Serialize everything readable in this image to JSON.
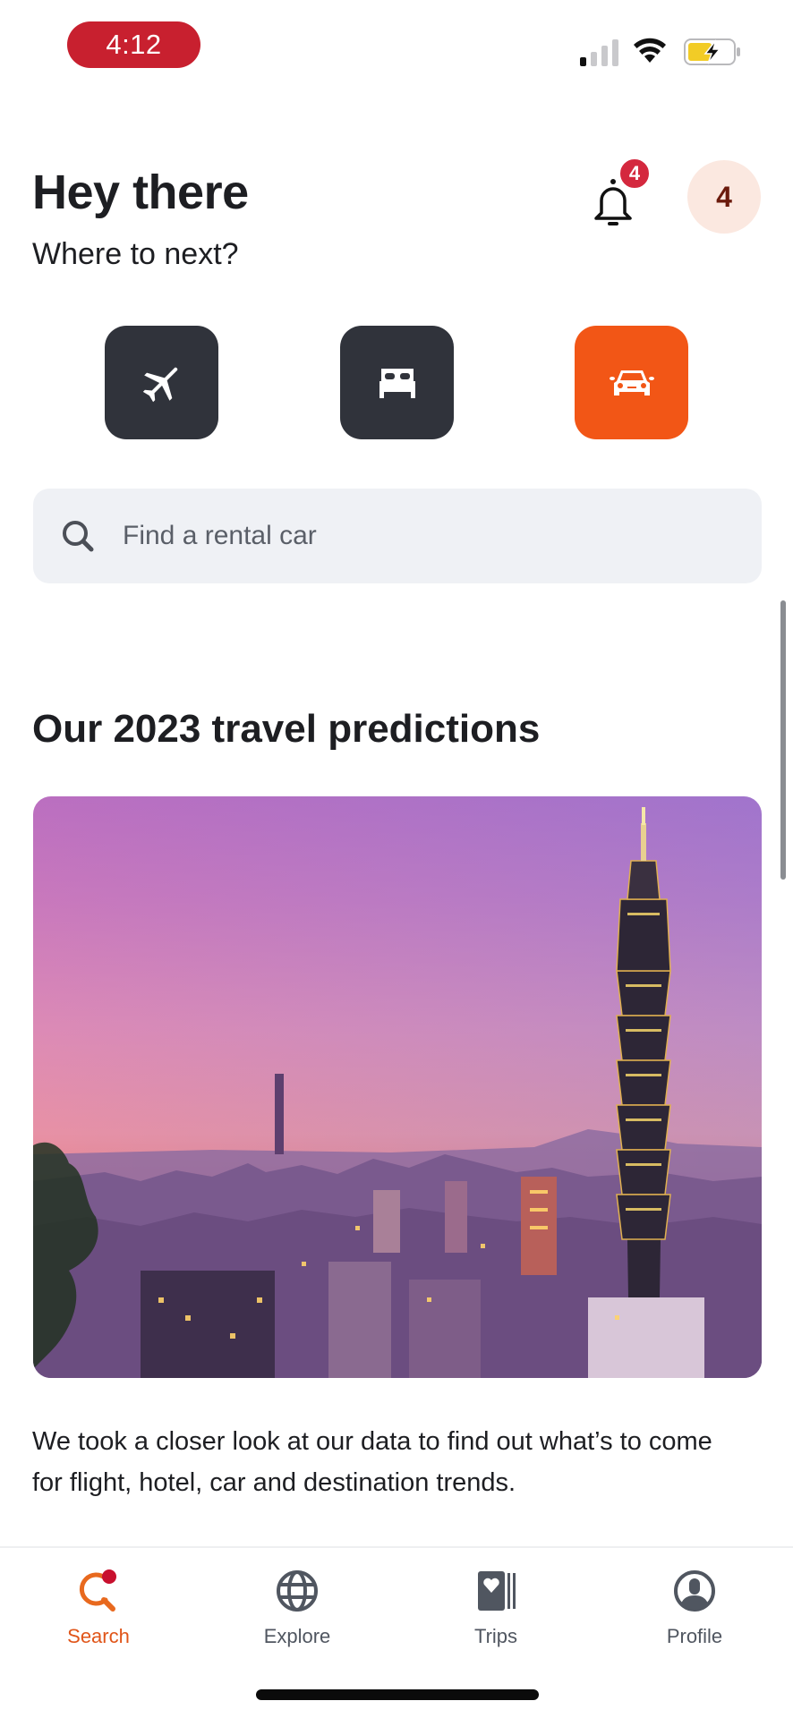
{
  "status_bar": {
    "time": "4:12",
    "icons": [
      "cellular-signal-icon",
      "wifi-icon",
      "battery-charging-icon"
    ]
  },
  "header": {
    "greeting": "Hey there",
    "subtitle": "Where to next?",
    "notifications": {
      "icon": "bell-icon",
      "badge_count": "4"
    },
    "avatar_initial": "4"
  },
  "categories": [
    {
      "name": "Flights",
      "icon": "airplane-icon",
      "active": false
    },
    {
      "name": "Hotels",
      "icon": "bed-icon",
      "active": false
    },
    {
      "name": "Cars",
      "icon": "car-icon",
      "active": true
    }
  ],
  "search": {
    "icon": "search-icon",
    "placeholder": "Find a rental car",
    "value": ""
  },
  "section": {
    "title": "Our 2023 travel predictions",
    "image_description": "Taipei city skyline at sunset with Taipei 101 tower",
    "description": "We took a closer look at our data to find out what’s to come for flight, hotel, car and destination trends."
  },
  "tabbar": {
    "tabs": [
      {
        "label": "Search",
        "icon": "search-tab-icon",
        "active": true,
        "has_dot": true
      },
      {
        "label": "Explore",
        "icon": "globe-icon",
        "active": false
      },
      {
        "label": "Trips",
        "icon": "trips-icon",
        "active": false
      },
      {
        "label": "Profile",
        "icon": "profile-icon",
        "active": false
      }
    ]
  },
  "colors": {
    "accent": "#f25616",
    "dark_button": "#30333b",
    "badge": "#d4283e",
    "time_pill": "#c8202f",
    "avatar_bg": "#fbe8e0",
    "search_bg": "#eff1f5"
  }
}
